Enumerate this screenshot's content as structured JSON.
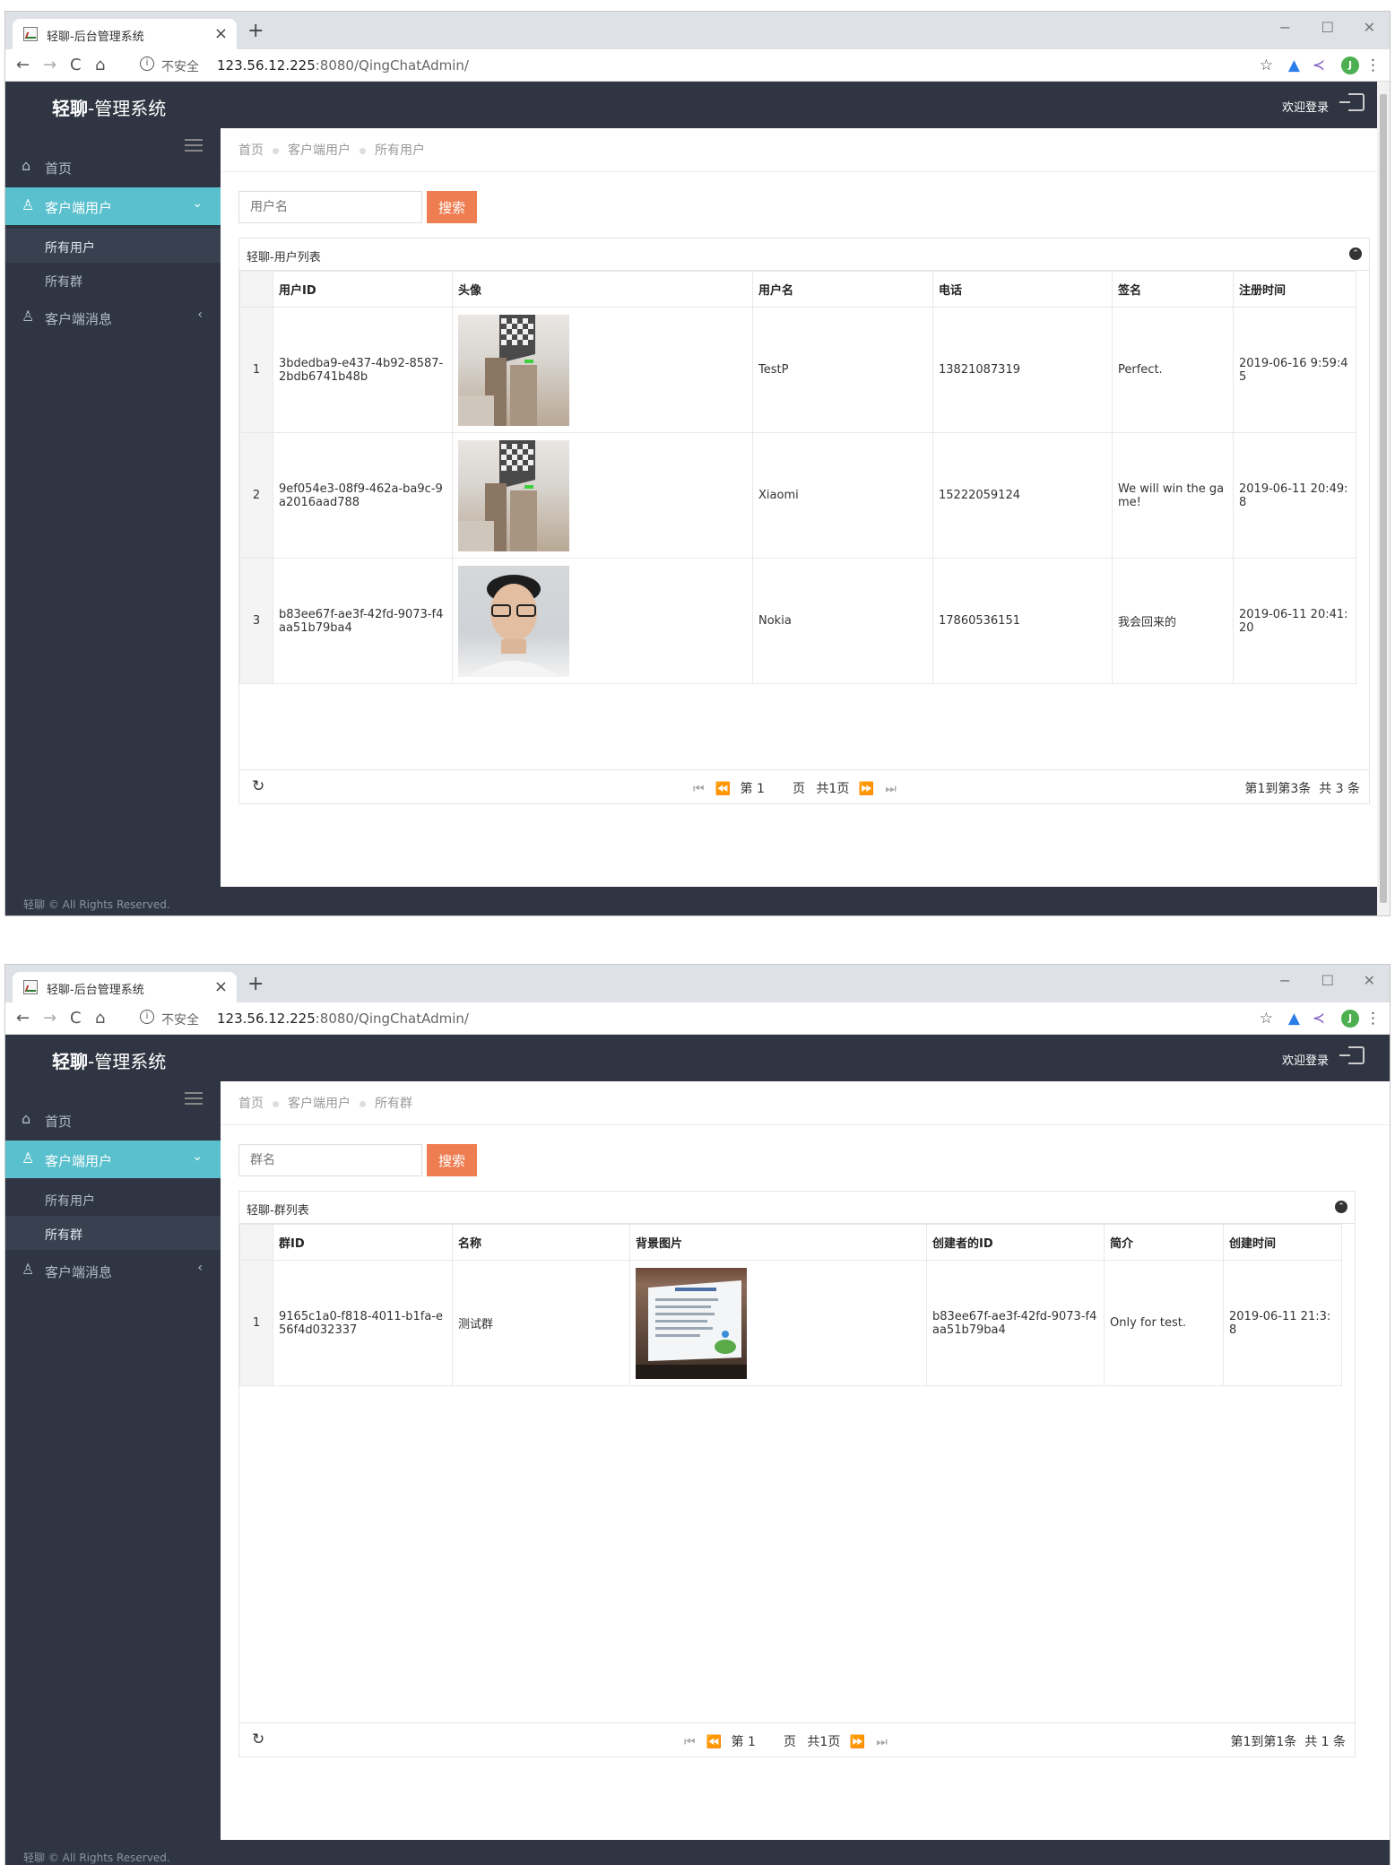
{
  "browser": {
    "tab_title": "轻聊-后台管理系统",
    "tab_close": "×",
    "new_tab": "+",
    "minimize": "−",
    "maximize": "☐",
    "close": "✕",
    "back": "←",
    "forward": "→",
    "reload": "C",
    "home": "⌂",
    "info_icon": "i",
    "insecure_label": "不安全",
    "url_host": "123.56.12.225",
    "url_rest": ":8080/QingChatAdmin/",
    "star": "☆",
    "ext1": "▲",
    "ext2": "≺",
    "profile_initial": "J",
    "menu": "⋮"
  },
  "app": {
    "brand_bold": "轻聊",
    "brand_rest": "-管理系统",
    "welcome": "欢迎登录",
    "footer": "轻聊 © All Rights Reserved."
  },
  "sidebar": {
    "home_icon": "⌂",
    "home": "首页",
    "users_icon": "♙",
    "client_users": "客户端用户",
    "caret_down": "⌄",
    "caret_left": "‹",
    "all_users": "所有用户",
    "all_groups": "所有群",
    "msg_icon": "♙",
    "client_messages": "客户端消息"
  },
  "screen1": {
    "breadcrumb": [
      "首页",
      "客户端用户",
      "所有用户"
    ],
    "search_placeholder": "用户名",
    "search_button": "搜索",
    "panel_title": "轻聊-用户列表",
    "collapse_icon": "⌃",
    "columns": [
      "用户ID",
      "头像",
      "用户名",
      "电话",
      "签名",
      "注册时间"
    ],
    "rows": [
      {
        "idx": "1",
        "id": "3bdedba9-e437-4b92-8587-2bdb6741b48b",
        "avatar": "ceiling-photo",
        "name": "TestP",
        "phone": "13821087319",
        "sign": "Perfect.",
        "time": "2019-06-16 9:59:45"
      },
      {
        "idx": "2",
        "id": "9ef054e3-08f9-462a-ba9c-9a2016aad788",
        "avatar": "ceiling-photo",
        "name": "Xiaomi",
        "phone": "15222059124",
        "sign": "We will win the game!",
        "time": "2019-06-11 20:49:8"
      },
      {
        "idx": "3",
        "id": "b83ee67f-ae3f-42fd-9073-f4aa51b79ba4",
        "avatar": "face-photo",
        "name": "Nokia",
        "phone": "17860536151",
        "sign": "我会回来的",
        "time": "2019-06-11 20:41:20"
      }
    ],
    "pager": {
      "refresh": "↻",
      "first": "⏮",
      "prev": "⏪",
      "page_prefix": "第",
      "page": "1",
      "page_suffix": "页",
      "total_pages": "共1页",
      "next": "⏩",
      "last": "⏭",
      "info_range": "第1到第3条",
      "info_total": "共 3 条"
    }
  },
  "screen2": {
    "breadcrumb": [
      "首页",
      "客户端用户",
      "所有群"
    ],
    "search_placeholder": "群名",
    "search_button": "搜索",
    "panel_title": "轻聊-群列表",
    "collapse_icon": "⌃",
    "columns": [
      "群ID",
      "名称",
      "背景图片",
      "创建者的ID",
      "简介",
      "创建时间"
    ],
    "rows": [
      {
        "idx": "1",
        "id": "9165c1a0-f818-4011-b1fa-e56f4d032337",
        "name": "测试群",
        "bg": "slide-photo",
        "creator": "b83ee67f-ae3f-42fd-9073-f4aa51b79ba4",
        "intro": "Only for test.",
        "time": "2019-06-11 21:3:8"
      }
    ],
    "pager": {
      "refresh": "↻",
      "first": "⏮",
      "prev": "⏪",
      "page_prefix": "第",
      "page": "1",
      "page_suffix": "页",
      "total_pages": "共1页",
      "next": "⏩",
      "last": "⏭",
      "info_range": "第1到第1条",
      "info_total": "共 1 条"
    }
  }
}
